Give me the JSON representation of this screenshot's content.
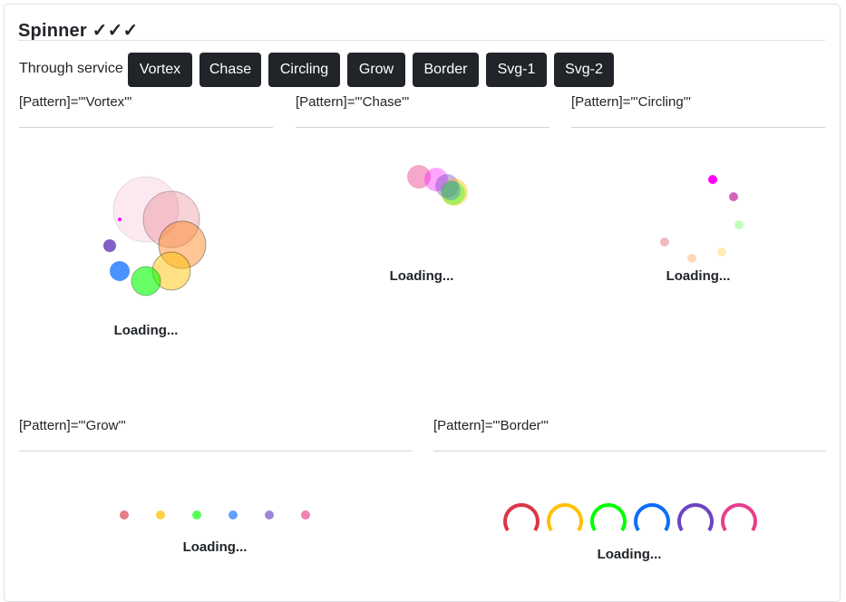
{
  "header": {
    "title": "Spinner ✓✓✓"
  },
  "toolbar": {
    "through_label": "Through service",
    "buttons": [
      "Vortex",
      "Chase",
      "Circling",
      "Grow",
      "Border",
      "Svg-1",
      "Svg-2"
    ]
  },
  "sections": {
    "vortex": {
      "label": "[Pattern]=\"'Vortex'\"",
      "loading": "Loading..."
    },
    "chase": {
      "label": "[Pattern]=\"'Chase'\"",
      "loading": "Loading..."
    },
    "circling": {
      "label": "[Pattern]=\"'Circling'\"",
      "loading": "Loading..."
    },
    "grow": {
      "label": "[Pattern]=\"'Grow'\"",
      "loading": "Loading..."
    },
    "border": {
      "label": "[Pattern]=\"'Border'\"",
      "loading": "Loading..."
    }
  },
  "colors": {
    "red": "#dc3545",
    "orange": "#fd7e14",
    "yellow": "#ffc107",
    "green": "#00ff00",
    "blue": "#0d6efd",
    "purple": "#6f42c1",
    "pink": "#e83e8c",
    "magenta": "#ff00ff",
    "button_bg": "#212529"
  }
}
